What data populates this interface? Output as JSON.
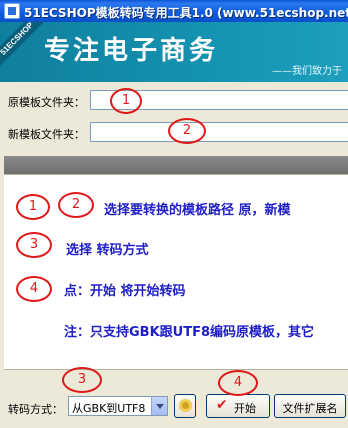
{
  "window": {
    "title": "51ECSHOP模板转码专用工具1.0 (www.51ecshop.net)"
  },
  "banner": {
    "ribbon": "51ECSHOP",
    "slogan": "专注电子商务",
    "tagline": "——我们致力于"
  },
  "form": {
    "source_label": "原模板文件夹：",
    "source_value": "",
    "target_label": "新模板文件夹：",
    "target_value": ""
  },
  "info": {
    "line1": "选择要转换的模板路径 原，新模",
    "line2": "选择 转码方式",
    "line3": "点：开始 将开始转码",
    "line4": "注：只支持GBK跟UTF8编码原模板，其它"
  },
  "bottom": {
    "mode_label": "转码方式：",
    "mode_value": "从GBK到UTF8",
    "start_label": "开始",
    "ext_label": "文件扩展名"
  },
  "markers": {
    "m1": "1",
    "m2": "2",
    "m3": "3",
    "m4": "4"
  },
  "icons": {
    "app": "app-icon",
    "settings": "gear-icon",
    "start": "checkmark-icon",
    "dropdown": "chevron-down-icon"
  }
}
